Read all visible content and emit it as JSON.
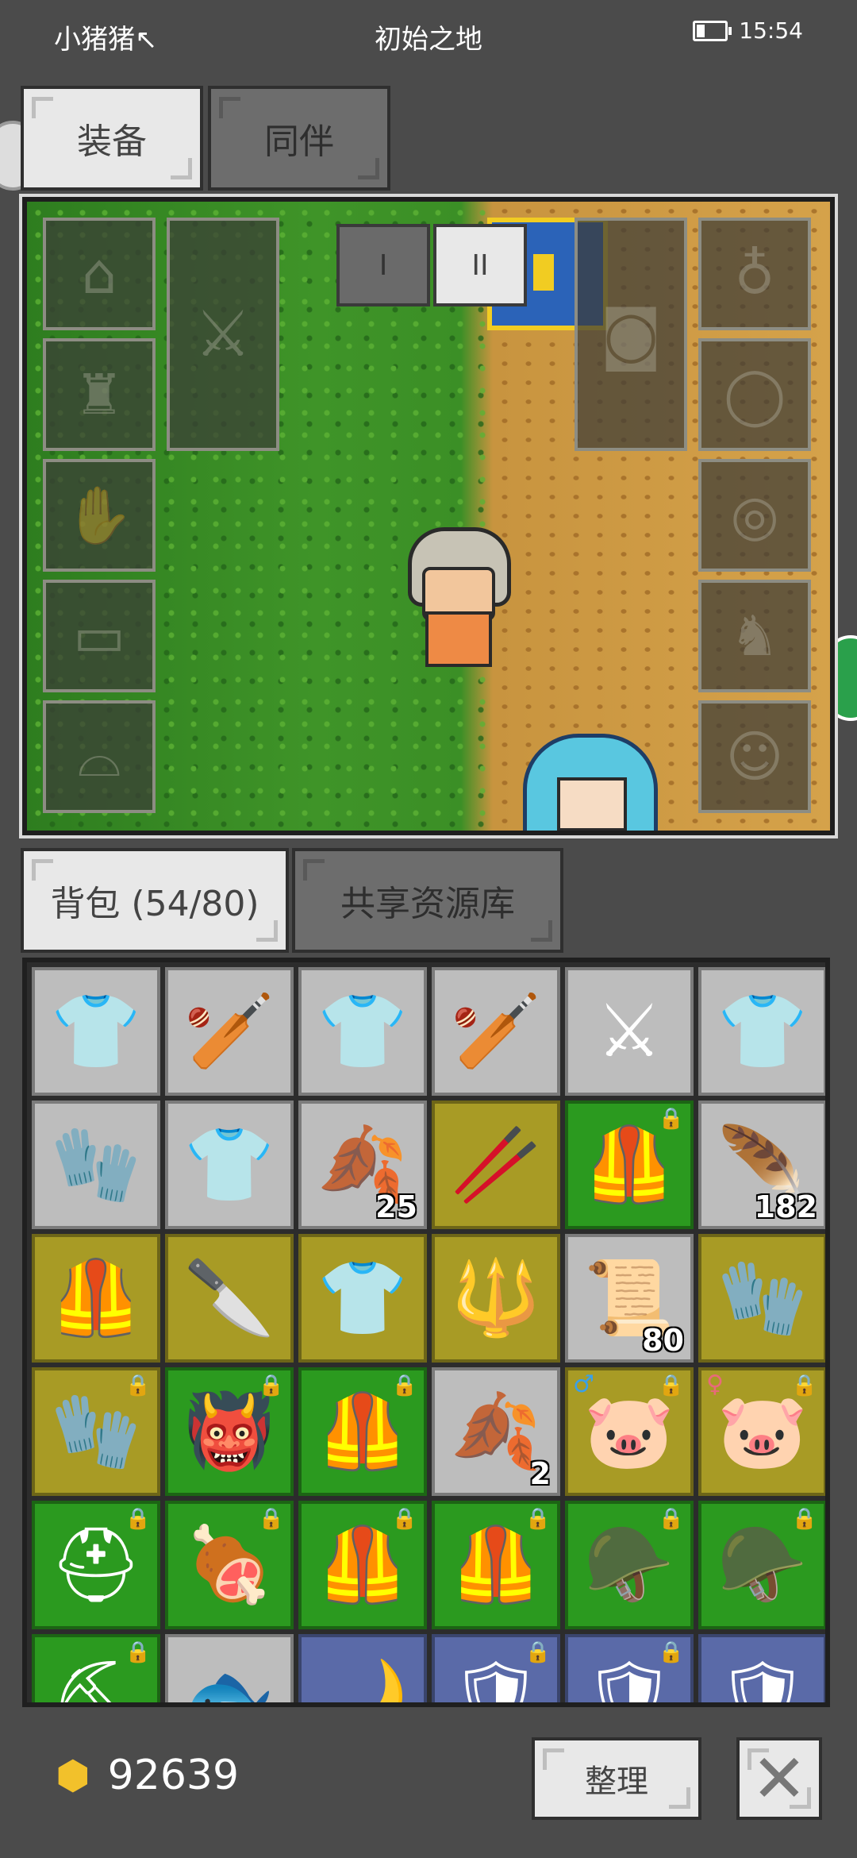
{
  "status_bar": {
    "carrier": "小猪猪↖",
    "title": "初始之地",
    "time": "15:54"
  },
  "top_tabs": [
    {
      "label": "装备"
    },
    {
      "label": "同伴"
    }
  ],
  "equipment": {
    "pager": [
      "I",
      "II"
    ],
    "left_slots": [
      "helmet-slot-icon",
      "armor-slot-icon",
      "gloves-slot-icon",
      "pants-slot-icon",
      "boots-slot-icon"
    ],
    "right_slots": [
      "amulet-slot-icon",
      "ring-slot-icon",
      "ring2-slot-icon",
      "belt-slot-icon",
      "pet-slot-icon"
    ]
  },
  "bag_tabs": [
    {
      "label": "背包 (54/80)"
    },
    {
      "label": "共享资源库"
    }
  ],
  "inventory": [
    {
      "icon": "👕",
      "bg": "gray"
    },
    {
      "icon": "🏏",
      "bg": "gray"
    },
    {
      "icon": "👕",
      "bg": "gray"
    },
    {
      "icon": "🏏",
      "bg": "gray"
    },
    {
      "icon": "⚔",
      "bg": "gray"
    },
    {
      "icon": "👕",
      "bg": "gray"
    },
    {
      "icon": "🧤",
      "bg": "gray"
    },
    {
      "icon": "👕",
      "bg": "gray"
    },
    {
      "icon": "🍂",
      "bg": "gray",
      "count": "25"
    },
    {
      "icon": "🥢",
      "bg": "olive"
    },
    {
      "icon": "🦺",
      "bg": "green",
      "locked": true
    },
    {
      "icon": "🪶",
      "bg": "gray",
      "count": "182"
    },
    {
      "icon": "🦺",
      "bg": "olive"
    },
    {
      "icon": "🔪",
      "bg": "olive"
    },
    {
      "icon": "👕",
      "bg": "olive"
    },
    {
      "icon": "🔱",
      "bg": "olive"
    },
    {
      "icon": "📜",
      "bg": "gray",
      "count": "80"
    },
    {
      "icon": "🧤",
      "bg": "olive"
    },
    {
      "icon": "🧤",
      "bg": "olive",
      "locked": true
    },
    {
      "icon": "👹",
      "bg": "green",
      "locked": true
    },
    {
      "icon": "🦺",
      "bg": "green",
      "locked": true
    },
    {
      "icon": "🍂",
      "bg": "gray",
      "count": "2"
    },
    {
      "icon": "🐷",
      "bg": "olive",
      "locked": true,
      "mark": "♂"
    },
    {
      "icon": "🐷",
      "bg": "olive",
      "locked": true,
      "mark": "♀"
    },
    {
      "icon": "⛑",
      "bg": "green",
      "locked": true
    },
    {
      "icon": "🍖",
      "bg": "green",
      "locked": true
    },
    {
      "icon": "🦺",
      "bg": "green",
      "locked": true
    },
    {
      "icon": "🦺",
      "bg": "green",
      "locked": true
    },
    {
      "icon": "🪖",
      "bg": "green",
      "locked": true
    },
    {
      "icon": "🪖",
      "bg": "green",
      "locked": true
    },
    {
      "icon": "⛏",
      "bg": "green",
      "locked": true
    },
    {
      "icon": "🐟",
      "bg": "gray"
    },
    {
      "icon": "🌙",
      "bg": "blue"
    },
    {
      "icon": "🛡",
      "bg": "blue",
      "locked": true
    },
    {
      "icon": "🛡",
      "bg": "blue",
      "locked": true
    },
    {
      "icon": "🛡",
      "bg": "blue"
    }
  ],
  "footer": {
    "gold": "92639",
    "sort_label": "整理",
    "close_label": "✕"
  }
}
